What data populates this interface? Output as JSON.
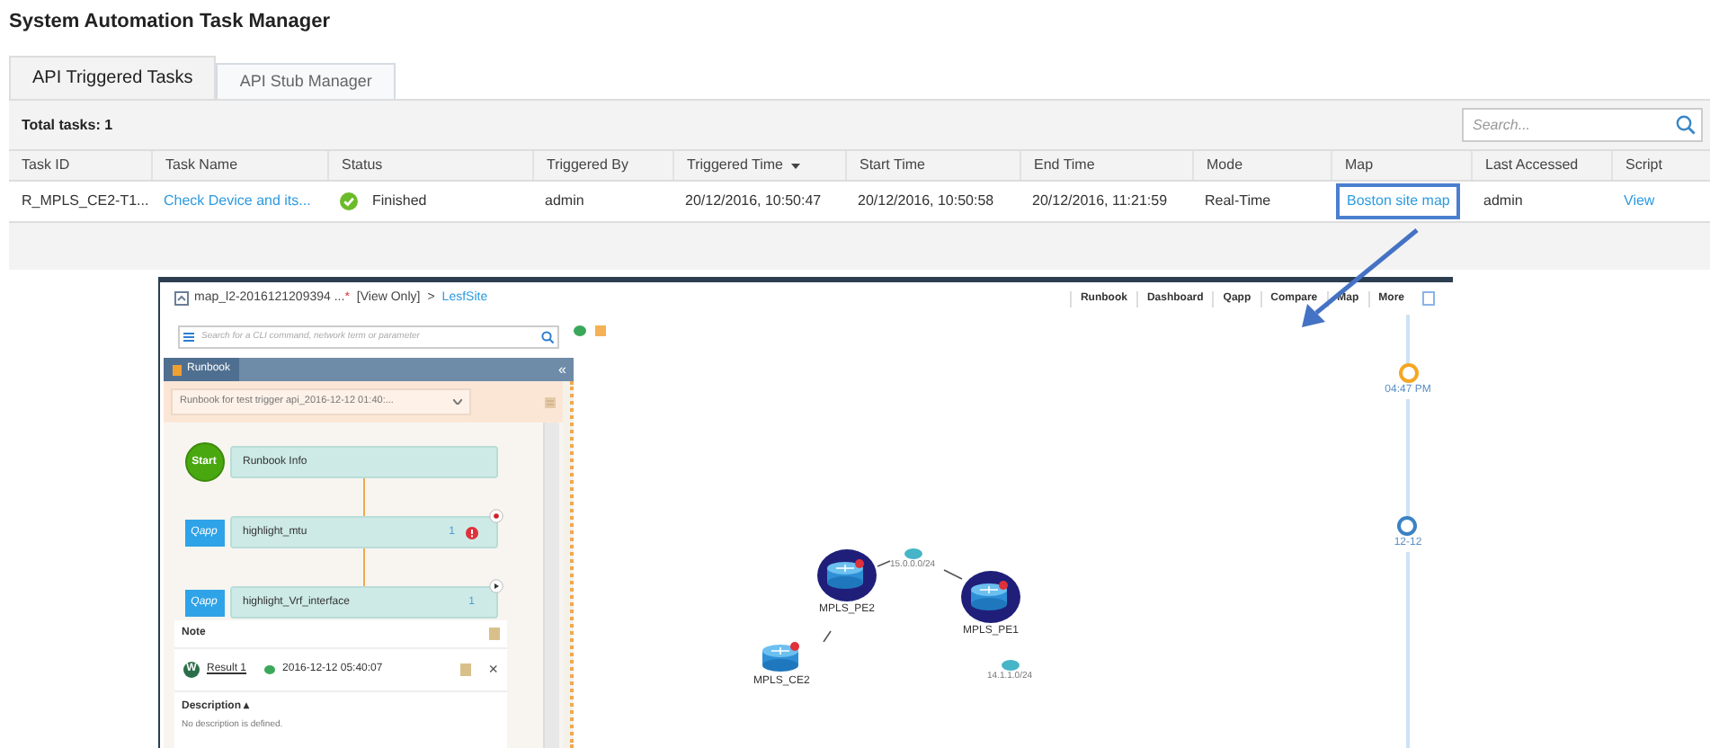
{
  "title": "System Automation Task Manager",
  "tabs": [
    {
      "label": "API Triggered Tasks",
      "selected": true
    },
    {
      "label": "API Stub Manager",
      "selected": false
    }
  ],
  "total_tasks": "Total tasks: 1",
  "search": {
    "placeholder": "Search..."
  },
  "table": {
    "columns": [
      {
        "label": "Task ID",
        "sorted": false
      },
      {
        "label": "Task Name",
        "sorted": false
      },
      {
        "label": "Status",
        "sorted": false
      },
      {
        "label": "Triggered By",
        "sorted": false
      },
      {
        "label": "Triggered Time",
        "sorted": true
      },
      {
        "label": "Start Time",
        "sorted": false
      },
      {
        "label": "End Time",
        "sorted": false
      },
      {
        "label": "Mode",
        "sorted": false
      },
      {
        "label": "Map",
        "sorted": false
      },
      {
        "label": "Last Accessed",
        "sorted": false
      },
      {
        "label": "Script",
        "sorted": false
      }
    ],
    "rows": [
      {
        "cells": [
          {
            "kind": "text",
            "text": "R_MPLS_CE2-T1..."
          },
          {
            "kind": "link",
            "text": "Check Device and its...",
            "highlighted": false
          },
          {
            "kind": "status",
            "text": "Finished"
          },
          {
            "kind": "text",
            "text": "admin"
          },
          {
            "kind": "text",
            "text": "20/12/2016, 10:50:47"
          },
          {
            "kind": "text",
            "text": "20/12/2016, 10:50:58"
          },
          {
            "kind": "text",
            "text": "20/12/2016, 11:21:59"
          },
          {
            "kind": "text",
            "text": "Real-Time"
          },
          {
            "kind": "link",
            "text": "Boston site map",
            "highlighted": true
          },
          {
            "kind": "text",
            "text": "admin"
          },
          {
            "kind": "link",
            "text": "View",
            "highlighted": false
          }
        ]
      }
    ]
  },
  "screenshot": {
    "breadcrumb": {
      "map": "map_l2-2016121209394 ...",
      "modified": "*",
      "mode": "[View Only]",
      "separator": ">",
      "site": "LesfSite"
    },
    "menu": [
      "Runbook",
      "Dashboard",
      "Qapp",
      "Compare",
      "Map",
      "More"
    ],
    "search": {
      "placeholder": "Search for a CLI command, network term or parameter"
    },
    "panel_tab": "Runbook",
    "collapse": "«",
    "runbook_select": "Runbook for test trigger api_2016-12-12 01:40:...",
    "steps": [
      {
        "kind": "start",
        "icon_label": "Start",
        "label": "Runbook Info"
      },
      {
        "kind": "qapp",
        "icon_label": "Qapp",
        "label": "highlight_mtu",
        "count": "1",
        "error": true
      },
      {
        "kind": "qapp",
        "icon_label": "Qapp",
        "label": "highlight_Vrf_interface",
        "count": "1",
        "error": false
      }
    ],
    "note": {
      "title": "Note",
      "badge": "W",
      "result": "Result 1",
      "date": "2016-12-12 05:40:07",
      "close": "×"
    },
    "description": {
      "title": "Description",
      "toggle": "▴",
      "text": "No description is defined."
    },
    "devices": [
      {
        "name": "MPLS_PE2",
        "selected": true
      },
      {
        "name": "MPLS_PE1",
        "selected": true
      },
      {
        "name": "MPLS_CE2",
        "selected": false
      }
    ],
    "subnets": [
      "15.0.0.0/24",
      "14.1.1.0/24"
    ],
    "timeline": [
      {
        "label": "04:47 PM",
        "color": "#f5a623"
      },
      {
        "label": "12-12",
        "color": "#3b82c4"
      }
    ]
  }
}
